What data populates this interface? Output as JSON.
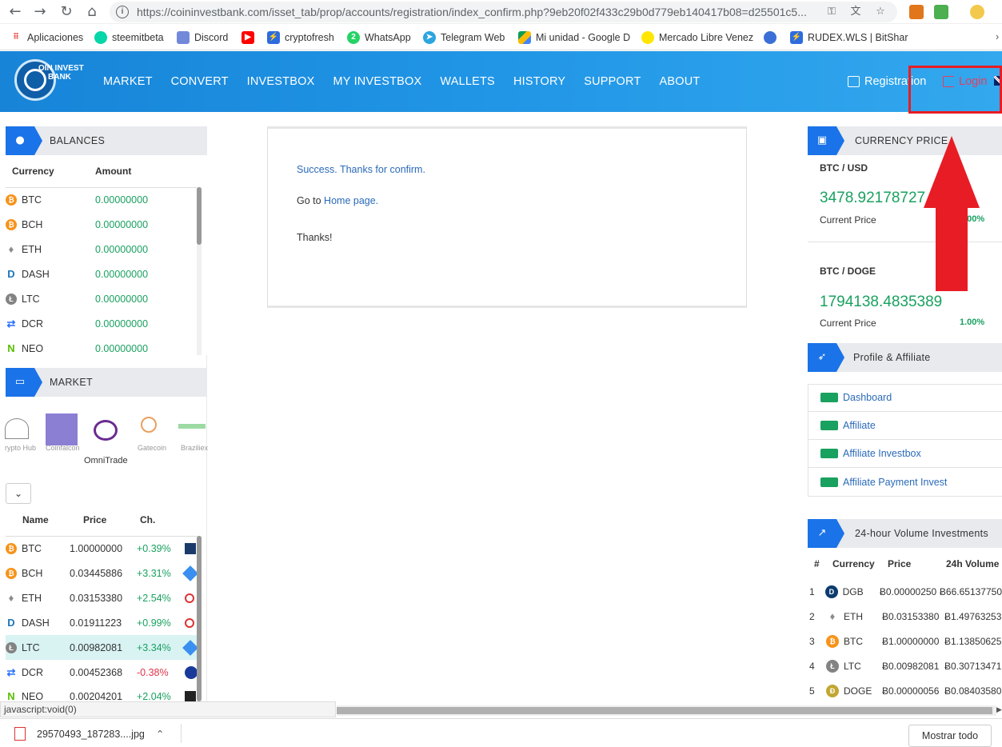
{
  "browser": {
    "url": "https://coininvestbank.com/isset_tab/prop/accounts/registration/index_confirm.php?9eb20f02f433c29b0d779eb140417b08=d25501c5...",
    "bookmarks": [
      {
        "label": "Aplicaciones",
        "color": "#ea4335"
      },
      {
        "label": "steemitbeta",
        "color": "#06d6a9"
      },
      {
        "label": "Discord",
        "color": "#7289da"
      },
      {
        "label": "",
        "color": "#ff0000"
      },
      {
        "label": "cryptofresh",
        "color": "#2d6cdf"
      },
      {
        "label": "WhatsApp",
        "color": "#25d366"
      },
      {
        "label": "Telegram Web",
        "color": "#2ca5e0"
      },
      {
        "label": "Mi unidad - Google D",
        "color": "#fbbc04"
      },
      {
        "label": "Mercado Libre Venez",
        "color": "#ffe600"
      },
      {
        "label": "",
        "color": "#3b6fd8"
      },
      {
        "label": "RUDEX.WLS | BitShar",
        "color": "#2d6cdf"
      }
    ],
    "status_text": "javascript:void(0)",
    "download_file": "29570493_187283....jpg",
    "show_all": "Mostrar todo"
  },
  "header": {
    "logo_text_1": "OIN INVEST",
    "logo_text_2": "BANK",
    "menu": [
      "MARKET",
      "CONVERT",
      "INVESTBOX",
      "MY INVESTBOX",
      "WALLETS",
      "HISTORY",
      "SUPPORT",
      "ABOUT"
    ],
    "registration": "Registration",
    "login": "Login"
  },
  "balances": {
    "title": "BALANCES",
    "col_currency": "Currency",
    "col_amount": "Amount",
    "rows": [
      {
        "currency": "BTC",
        "amount": "0.00000000",
        "color": "#f7931a"
      },
      {
        "currency": "BCH",
        "amount": "0.00000000",
        "color": "#f7931a"
      },
      {
        "currency": "ETH",
        "amount": "0.00000000",
        "color": "#8c8c8c"
      },
      {
        "currency": "DASH",
        "amount": "0.00000000",
        "color": "#1c75bc"
      },
      {
        "currency": "LTC",
        "amount": "0.00000000",
        "color": "#838383"
      },
      {
        "currency": "DCR",
        "amount": "0.00000000",
        "color": "#2970ff"
      },
      {
        "currency": "NEO",
        "amount": "0.00000000",
        "color": "#58bf00"
      }
    ]
  },
  "market": {
    "title": "MARKET",
    "exchanges": [
      {
        "name": "rypto Hub",
        "color": "#777"
      },
      {
        "name": "Coinfalcon",
        "color": "#8b7fd4"
      },
      {
        "name": "OmniTrade",
        "color": "#6a2c91"
      },
      {
        "name": "Gatecoin",
        "color": "#e8a060"
      },
      {
        "name": "Braziliex",
        "color": "#39b54a"
      }
    ],
    "selected_exchange": "OmniTrade",
    "col_name": "Name",
    "col_price": "Price",
    "col_change": "Ch.",
    "rows": [
      {
        "name": "BTC",
        "price": "1.00000000",
        "change": "+0.39%",
        "dir": "up",
        "color": "#f7931a",
        "badge": "#1a3a6a"
      },
      {
        "name": "BCH",
        "price": "0.03445886",
        "change": "+3.31%",
        "dir": "up",
        "color": "#f7931a",
        "badge": "#3a8ff0"
      },
      {
        "name": "ETH",
        "price": "0.03153380",
        "change": "+2.54%",
        "dir": "up",
        "color": "#8c8c8c",
        "badge": "#d33"
      },
      {
        "name": "DASH",
        "price": "0.01911223",
        "change": "+0.99%",
        "dir": "up",
        "color": "#1c75bc",
        "badge": "#d33"
      },
      {
        "name": "LTC",
        "price": "0.00982081",
        "change": "+3.34%",
        "dir": "up",
        "color": "#838383",
        "badge": "#3a8ff0"
      },
      {
        "name": "DCR",
        "price": "0.00452368",
        "change": "-0.38%",
        "dir": "down",
        "color": "#2970ff",
        "badge": "#1a3a9a"
      },
      {
        "name": "NEO",
        "price": "0.00204201",
        "change": "+2.04%",
        "dir": "up",
        "color": "#58bf00",
        "badge": "#222"
      }
    ]
  },
  "confirm": {
    "success": "Success. Thanks for confirm.",
    "goto": "Go to ",
    "home_link": "Home page.",
    "thanks": "Thanks!"
  },
  "currency_price": {
    "title": "CURRENCY PRICE",
    "pairs": [
      {
        "pair": "BTC / USD",
        "price": "3478.92178727",
        "label": "Current Price",
        "change": "1.00%"
      },
      {
        "pair": "BTC / DOGE",
        "price": "1794138.4835389",
        "label": "Current Price",
        "change": "1.00%"
      }
    ]
  },
  "profile": {
    "title": "Profile & Affiliate",
    "links": [
      "Dashboard",
      "Affiliate",
      "Affiliate Investbox",
      "Affiliate Payment Invest"
    ]
  },
  "volume": {
    "title": "24-hour Volume Investments",
    "col_num": "#",
    "col_currency": "Currency",
    "col_price": "Price",
    "col_volume": "24h Volume",
    "rows": [
      {
        "n": "1",
        "currency": "DGB",
        "price": "Ƀ0.00000250",
        "volume": "Ƀ66.65137750",
        "color": "#0c3b6e"
      },
      {
        "n": "2",
        "currency": "ETH",
        "price": "Ƀ0.03153380",
        "volume": "Ƀ1.49763253",
        "color": "#8c8c8c"
      },
      {
        "n": "3",
        "currency": "BTC",
        "price": "Ƀ1.00000000",
        "volume": "Ƀ1.13850625",
        "color": "#f7931a"
      },
      {
        "n": "4",
        "currency": "LTC",
        "price": "Ƀ0.00982081",
        "volume": "Ƀ0.30713471",
        "color": "#838383"
      },
      {
        "n": "5",
        "currency": "DOGE",
        "price": "Ƀ0.00000056",
        "volume": "Ƀ0.08403580",
        "color": "#c2a633"
      }
    ]
  }
}
